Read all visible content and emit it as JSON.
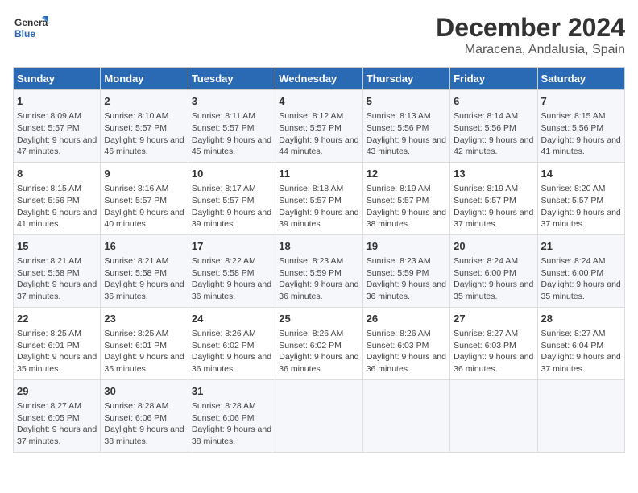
{
  "logo": {
    "line1": "General",
    "line2": "Blue"
  },
  "title": "December 2024",
  "subtitle": "Maracena, Andalusia, Spain",
  "headers": [
    "Sunday",
    "Monday",
    "Tuesday",
    "Wednesday",
    "Thursday",
    "Friday",
    "Saturday"
  ],
  "weeks": [
    [
      {
        "day": "1",
        "sunrise": "Sunrise: 8:09 AM",
        "sunset": "Sunset: 5:57 PM",
        "daylight": "Daylight: 9 hours and 47 minutes."
      },
      {
        "day": "2",
        "sunrise": "Sunrise: 8:10 AM",
        "sunset": "Sunset: 5:57 PM",
        "daylight": "Daylight: 9 hours and 46 minutes."
      },
      {
        "day": "3",
        "sunrise": "Sunrise: 8:11 AM",
        "sunset": "Sunset: 5:57 PM",
        "daylight": "Daylight: 9 hours and 45 minutes."
      },
      {
        "day": "4",
        "sunrise": "Sunrise: 8:12 AM",
        "sunset": "Sunset: 5:57 PM",
        "daylight": "Daylight: 9 hours and 44 minutes."
      },
      {
        "day": "5",
        "sunrise": "Sunrise: 8:13 AM",
        "sunset": "Sunset: 5:56 PM",
        "daylight": "Daylight: 9 hours and 43 minutes."
      },
      {
        "day": "6",
        "sunrise": "Sunrise: 8:14 AM",
        "sunset": "Sunset: 5:56 PM",
        "daylight": "Daylight: 9 hours and 42 minutes."
      },
      {
        "day": "7",
        "sunrise": "Sunrise: 8:15 AM",
        "sunset": "Sunset: 5:56 PM",
        "daylight": "Daylight: 9 hours and 41 minutes."
      }
    ],
    [
      {
        "day": "8",
        "sunrise": "Sunrise: 8:15 AM",
        "sunset": "Sunset: 5:56 PM",
        "daylight": "Daylight: 9 hours and 41 minutes."
      },
      {
        "day": "9",
        "sunrise": "Sunrise: 8:16 AM",
        "sunset": "Sunset: 5:57 PM",
        "daylight": "Daylight: 9 hours and 40 minutes."
      },
      {
        "day": "10",
        "sunrise": "Sunrise: 8:17 AM",
        "sunset": "Sunset: 5:57 PM",
        "daylight": "Daylight: 9 hours and 39 minutes."
      },
      {
        "day": "11",
        "sunrise": "Sunrise: 8:18 AM",
        "sunset": "Sunset: 5:57 PM",
        "daylight": "Daylight: 9 hours and 39 minutes."
      },
      {
        "day": "12",
        "sunrise": "Sunrise: 8:19 AM",
        "sunset": "Sunset: 5:57 PM",
        "daylight": "Daylight: 9 hours and 38 minutes."
      },
      {
        "day": "13",
        "sunrise": "Sunrise: 8:19 AM",
        "sunset": "Sunset: 5:57 PM",
        "daylight": "Daylight: 9 hours and 37 minutes."
      },
      {
        "day": "14",
        "sunrise": "Sunrise: 8:20 AM",
        "sunset": "Sunset: 5:57 PM",
        "daylight": "Daylight: 9 hours and 37 minutes."
      }
    ],
    [
      {
        "day": "15",
        "sunrise": "Sunrise: 8:21 AM",
        "sunset": "Sunset: 5:58 PM",
        "daylight": "Daylight: 9 hours and 37 minutes."
      },
      {
        "day": "16",
        "sunrise": "Sunrise: 8:21 AM",
        "sunset": "Sunset: 5:58 PM",
        "daylight": "Daylight: 9 hours and 36 minutes."
      },
      {
        "day": "17",
        "sunrise": "Sunrise: 8:22 AM",
        "sunset": "Sunset: 5:58 PM",
        "daylight": "Daylight: 9 hours and 36 minutes."
      },
      {
        "day": "18",
        "sunrise": "Sunrise: 8:23 AM",
        "sunset": "Sunset: 5:59 PM",
        "daylight": "Daylight: 9 hours and 36 minutes."
      },
      {
        "day": "19",
        "sunrise": "Sunrise: 8:23 AM",
        "sunset": "Sunset: 5:59 PM",
        "daylight": "Daylight: 9 hours and 36 minutes."
      },
      {
        "day": "20",
        "sunrise": "Sunrise: 8:24 AM",
        "sunset": "Sunset: 6:00 PM",
        "daylight": "Daylight: 9 hours and 35 minutes."
      },
      {
        "day": "21",
        "sunrise": "Sunrise: 8:24 AM",
        "sunset": "Sunset: 6:00 PM",
        "daylight": "Daylight: 9 hours and 35 minutes."
      }
    ],
    [
      {
        "day": "22",
        "sunrise": "Sunrise: 8:25 AM",
        "sunset": "Sunset: 6:01 PM",
        "daylight": "Daylight: 9 hours and 35 minutes."
      },
      {
        "day": "23",
        "sunrise": "Sunrise: 8:25 AM",
        "sunset": "Sunset: 6:01 PM",
        "daylight": "Daylight: 9 hours and 35 minutes."
      },
      {
        "day": "24",
        "sunrise": "Sunrise: 8:26 AM",
        "sunset": "Sunset: 6:02 PM",
        "daylight": "Daylight: 9 hours and 36 minutes."
      },
      {
        "day": "25",
        "sunrise": "Sunrise: 8:26 AM",
        "sunset": "Sunset: 6:02 PM",
        "daylight": "Daylight: 9 hours and 36 minutes."
      },
      {
        "day": "26",
        "sunrise": "Sunrise: 8:26 AM",
        "sunset": "Sunset: 6:03 PM",
        "daylight": "Daylight: 9 hours and 36 minutes."
      },
      {
        "day": "27",
        "sunrise": "Sunrise: 8:27 AM",
        "sunset": "Sunset: 6:03 PM",
        "daylight": "Daylight: 9 hours and 36 minutes."
      },
      {
        "day": "28",
        "sunrise": "Sunrise: 8:27 AM",
        "sunset": "Sunset: 6:04 PM",
        "daylight": "Daylight: 9 hours and 37 minutes."
      }
    ],
    [
      {
        "day": "29",
        "sunrise": "Sunrise: 8:27 AM",
        "sunset": "Sunset: 6:05 PM",
        "daylight": "Daylight: 9 hours and 37 minutes."
      },
      {
        "day": "30",
        "sunrise": "Sunrise: 8:28 AM",
        "sunset": "Sunset: 6:06 PM",
        "daylight": "Daylight: 9 hours and 38 minutes."
      },
      {
        "day": "31",
        "sunrise": "Sunrise: 8:28 AM",
        "sunset": "Sunset: 6:06 PM",
        "daylight": "Daylight: 9 hours and 38 minutes."
      },
      null,
      null,
      null,
      null
    ]
  ]
}
